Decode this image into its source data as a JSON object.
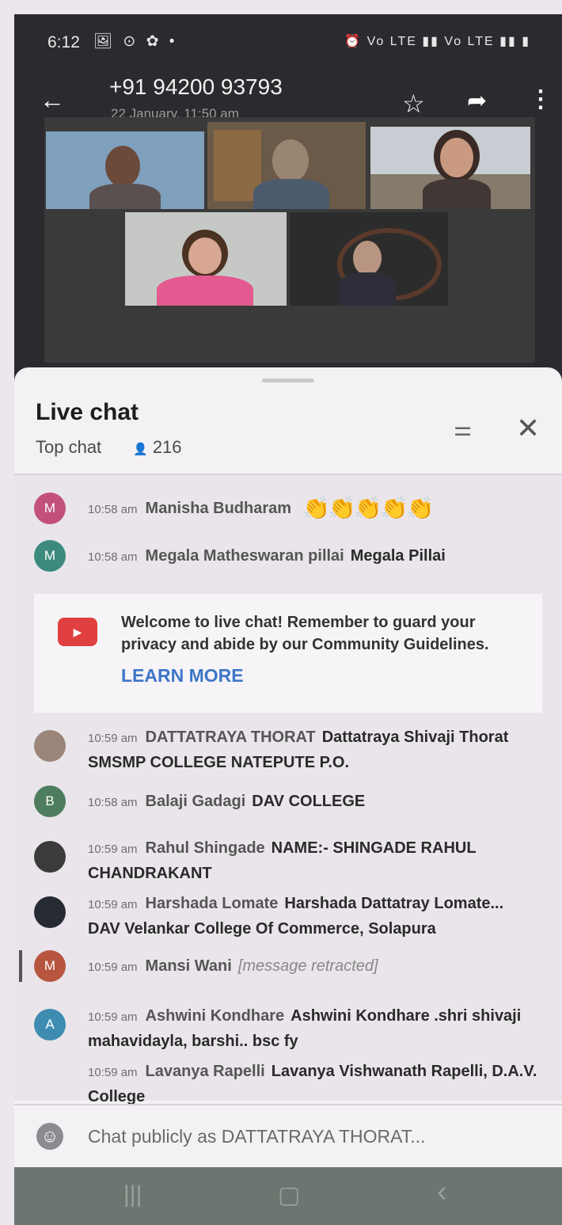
{
  "status_bar": {
    "time": "6:12",
    "left_icons": "🖼 ⊙ ✿ •",
    "right_icons": "⏰ Vo LTE ▮▮ Vo LTE ▮▮ ▮"
  },
  "header": {
    "title": "+91 94200 93793",
    "subtitle": "22 January, 11:50 am",
    "back_icon": "←",
    "star_icon": "☆",
    "share_icon": "➦",
    "menu_icon": "⋮"
  },
  "live_chat": {
    "title": "Live chat",
    "mode": "Top chat",
    "viewers": "216",
    "viewers_icon": "👤",
    "filter_icon": "⚌",
    "close_icon": "✕"
  },
  "messages": [
    {
      "avatar": "M",
      "avatar_color": "#c2507a",
      "time": "10:58 am",
      "author": "Manisha Budharam",
      "text": "",
      "claps": "👏👏👏👏👏"
    },
    {
      "avatar": "M",
      "avatar_color": "#3c8a7d",
      "time": "10:58 am",
      "author": "Megala Matheswaran pillai",
      "text": "Megala Pillai"
    },
    {
      "avatar": "",
      "avatar_color": "#9b8478",
      "time": "10:59 am",
      "author": "DATTATRAYA THORAT",
      "text": "Dattatraya Shivaji Thorat SMSMP COLLEGE NATEPUTE P.O."
    },
    {
      "avatar": "B",
      "avatar_color": "#4d7d5e",
      "time": "10:58 am",
      "author": "Balaji Gadagi",
      "text": "DAV COLLEGE"
    },
    {
      "avatar": "",
      "avatar_color": "#3b3b3b",
      "time": "10:59 am",
      "author": "Rahul Shingade",
      "text": "NAME:- SHINGADE RAHUL CHANDRAKANT"
    },
    {
      "avatar": "",
      "avatar_color": "#262b33",
      "time": "10:59 am",
      "author": "Harshada Lomate",
      "text": "Harshada Dattatray Lomate... DAV Velankar College Of Commerce, Solapura"
    },
    {
      "avatar": "M",
      "avatar_color": "#b8553f",
      "time": "10:59 am",
      "author": "Mansi Wani",
      "text": "[message retracted]"
    },
    {
      "avatar": "A",
      "avatar_color": "#3e8db0",
      "time": "10:59 am",
      "author": "Ashwini Kondhare",
      "text": "Ashwini Kondhare .shri shivaji mahavidayla, barshi.. bsc fy"
    },
    {
      "avatar": "",
      "avatar_color": "",
      "time": "10:59 am",
      "author": "Lavanya Rapelli",
      "text": "Lavanya Vishwanath Rapelli, D.A.V. College"
    }
  ],
  "welcome": {
    "text": "Welcome to live chat! Remember to guard your privacy and abide by our Community Guidelines.",
    "learn_more": "LEARN MORE",
    "yt_icon": "▶"
  },
  "input": {
    "placeholder": "Chat publicly as DATTATRAYA THORAT...",
    "emoji_icon": "☺"
  },
  "nav_bar": {
    "recents_icon": "|||",
    "home_icon": "▢",
    "back_icon": "‹"
  }
}
